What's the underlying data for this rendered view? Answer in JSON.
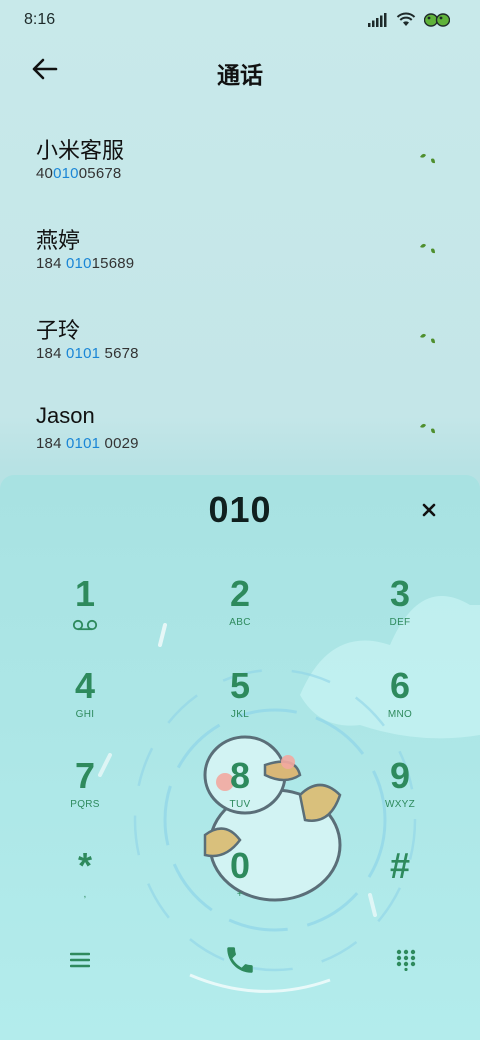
{
  "status_bar": {
    "time": "8:16",
    "icons": [
      "signal-icon",
      "wifi-icon",
      "battery-icon"
    ]
  },
  "header": {
    "back_icon": "back-arrow-icon",
    "title": "通话"
  },
  "contacts": [
    {
      "name": "小米客服",
      "number_pre": "40",
      "number_hl": "010",
      "number_post": "05678",
      "icon": "call-leaf-icon"
    },
    {
      "name": "燕婷",
      "number_pre": "184 ",
      "number_hl": "010",
      "number_post": "15689",
      "icon": "call-leaf-icon"
    },
    {
      "name": "子玲",
      "number_pre": "184 ",
      "number_hl": "0101",
      "number_post": " 5678",
      "icon": "call-leaf-icon"
    },
    {
      "name": "Jason",
      "number_pre": "184 ",
      "number_hl": "0101",
      "number_post": " 0029",
      "icon": "call-leaf-icon"
    }
  ],
  "dialpad": {
    "display": "010",
    "clear_icon": "close-icon",
    "keys": [
      {
        "digit": "1",
        "sub": ""
      },
      {
        "digit": "2",
        "sub": "ABC"
      },
      {
        "digit": "3",
        "sub": "DEF"
      },
      {
        "digit": "4",
        "sub": "GHI"
      },
      {
        "digit": "5",
        "sub": "JKL"
      },
      {
        "digit": "6",
        "sub": "MNO"
      },
      {
        "digit": "7",
        "sub": "PQRS"
      },
      {
        "digit": "8",
        "sub": "TUV"
      },
      {
        "digit": "9",
        "sub": "WXYZ"
      },
      {
        "digit": "*",
        "sub": ","
      },
      {
        "digit": "0",
        "sub": "+"
      },
      {
        "digit": "#",
        "sub": ""
      }
    ],
    "bottom": {
      "menu_icon": "menu-icon",
      "call_icon": "phone-call-icon",
      "keypad_icon": "keypad-toggle-icon"
    }
  },
  "colors": {
    "accent_green": "#2e8a5d",
    "highlight_blue": "#1b86d6",
    "panel_bg": "#ace6e6"
  }
}
